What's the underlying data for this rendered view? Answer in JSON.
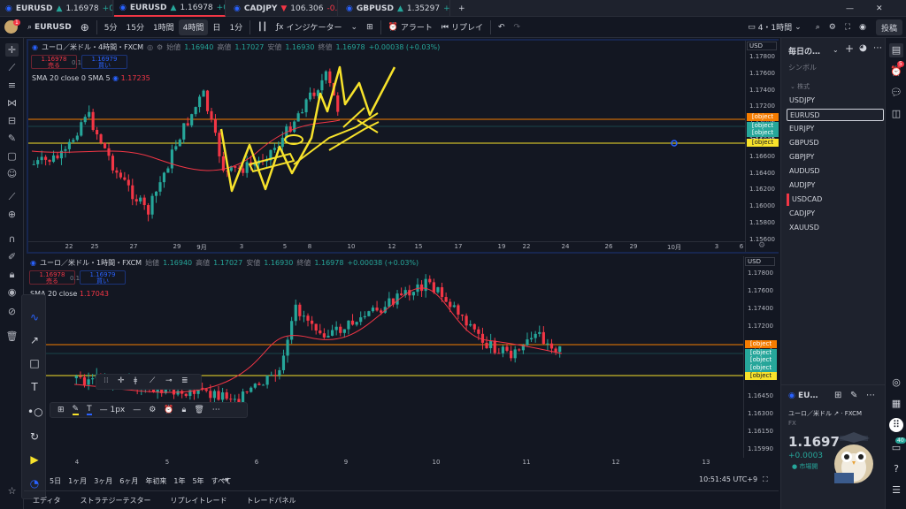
{
  "colors": {
    "up": "#26a69a",
    "down": "#f23645",
    "accent": "#2962ff",
    "orange": "#f57c00",
    "yellow": "#f7e22b",
    "bg": "#131722"
  },
  "tabs": [
    {
      "sym": "EURUSD",
      "arrow": "▲",
      "price": "1.16978",
      "chg": "+0.0…",
      "dir": "up",
      "left": 0,
      "width": 128
    },
    {
      "sym": "EURUSD",
      "arrow": "▲",
      "price": "1.16978",
      "chg": "+0.0…",
      "dir": "up",
      "left": 129,
      "width": 126,
      "active": true
    },
    {
      "sym": "CADJPY",
      "arrow": "▼",
      "price": "106.306",
      "chg": "-0.5…",
      "dir": "dn",
      "left": 258,
      "width": 124
    },
    {
      "sym": "GBPUSD",
      "arrow": "▲",
      "price": "1.35297",
      "chg": "+0.0…",
      "dir": "up",
      "left": 385,
      "width": 124
    }
  ],
  "toolbar": {
    "avatar_badge": "1",
    "symbol": "EURUSD",
    "timeframes": [
      "5分",
      "15分",
      "1時間",
      "4時間",
      "日",
      "1分"
    ],
    "selected_timeframe": "4時間",
    "indicators": "インジケーター",
    "alert": "アラート",
    "replay": "リプレイ",
    "layout": "4・1時間",
    "publish": "投稿"
  },
  "pane1": {
    "title": "ユーロ／米ドル・4時間・FXCM",
    "ohlc": {
      "o_label": "始値",
      "o": "1.16940",
      "h_label": "高値",
      "h": "1.17027",
      "l_label": "安値",
      "l": "1.16930",
      "c_label": "終値",
      "c": "1.16978",
      "chg": "+0.00038 (+0.03%)"
    },
    "sell": {
      "price": "1.16978",
      "label": "売る"
    },
    "qty": "0.1",
    "buy": {
      "price": "1.16979",
      "label": "買い"
    },
    "sma_label": "SMA 20 close 0 SMA 5",
    "sma_value": "1.17235",
    "currency": "USD",
    "yticks": [
      "1.17800",
      "1.17600",
      "1.17400",
      "1.17200",
      "1.17000",
      "1.16800",
      "1.16600",
      "1.16400",
      "1.16200",
      "1.16000",
      "1.15800",
      "1.15600"
    ],
    "xticks": [
      "22",
      "25",
      "27",
      "29",
      "9月",
      "3",
      "5",
      "8",
      "10",
      "12",
      "15",
      "17",
      "19",
      "22",
      "24",
      "26",
      "29",
      "10月",
      "3",
      "6"
    ],
    "price_labels": [
      {
        "text": "1.17067",
        "kind": "orange"
      },
      {
        "text": "1.16978",
        "kind": "green"
      },
      {
        "text": "03:08:14",
        "kind": "green"
      },
      {
        "text": "1.16757",
        "kind": "yellow"
      }
    ]
  },
  "pane2": {
    "title": "ユーロ／米ドル・1時間・FXCM",
    "ohlc": {
      "o_label": "始値",
      "o": "1.16940",
      "h_label": "高値",
      "h": "1.17027",
      "l_label": "安値",
      "l": "1.16930",
      "c_label": "終値",
      "c": "1.16978",
      "chg": "+0.00038 (+0.03%)"
    },
    "sell": {
      "price": "1.16978",
      "label": "売る"
    },
    "qty": "0.1",
    "buy": {
      "price": "1.16979",
      "label": "買い"
    },
    "sma_label": "SMA 20 close",
    "sma_value": "1.17043",
    "currency": "USD",
    "yticks": [
      "1.17800",
      "1.17600",
      "1.17400",
      "1.17200",
      "1.17000",
      "1.16800",
      "1.16600",
      "1.16450",
      "1.16300",
      "1.16150",
      "1.15990"
    ],
    "xticks": [
      "4",
      "5",
      "6",
      "9",
      "10",
      "11",
      "12",
      "13"
    ],
    "price_labels": [
      {
        "text": "1.17067",
        "kind": "orange"
      },
      {
        "text": "1.16978",
        "kind": "green"
      },
      {
        "text": "08:14",
        "kind": "green"
      },
      {
        "text": "1.16948",
        "kind": "green"
      },
      {
        "text": "1.16757",
        "kind": "yellow"
      }
    ]
  },
  "bottom": {
    "ranges": [
      "5日",
      "1ヶ月",
      "3ヶ月",
      "6ヶ月",
      "年初来",
      "1年",
      "5年",
      "すべて"
    ],
    "clock": "10:51:45 UTC+9"
  },
  "footer": [
    "エディタ",
    "ストラテジーテスター",
    "リプレイトレード",
    "トレードパネル"
  ],
  "watchlist": {
    "title": "毎日の…",
    "col": "シンボル",
    "group": "株式",
    "items": [
      "USDJPY",
      "EURUSD",
      "EURJPY",
      "GBPUSD",
      "GBPJPY",
      "AUDUSD",
      "AUDJPY",
      "USDCAD",
      "CADJPY",
      "XAUUSD"
    ],
    "selected": "EURUSD"
  },
  "detail": {
    "sym": "EU…",
    "name": "ユーロ／米ドル",
    "exch": "FXCM",
    "type": "FX",
    "price": "1.1697",
    "chg": "+0.0003",
    "status": "市場開"
  },
  "rbar_badges": {
    "notif": "5",
    "msg": "40"
  },
  "drawbar": {
    "width_label": "1px"
  }
}
